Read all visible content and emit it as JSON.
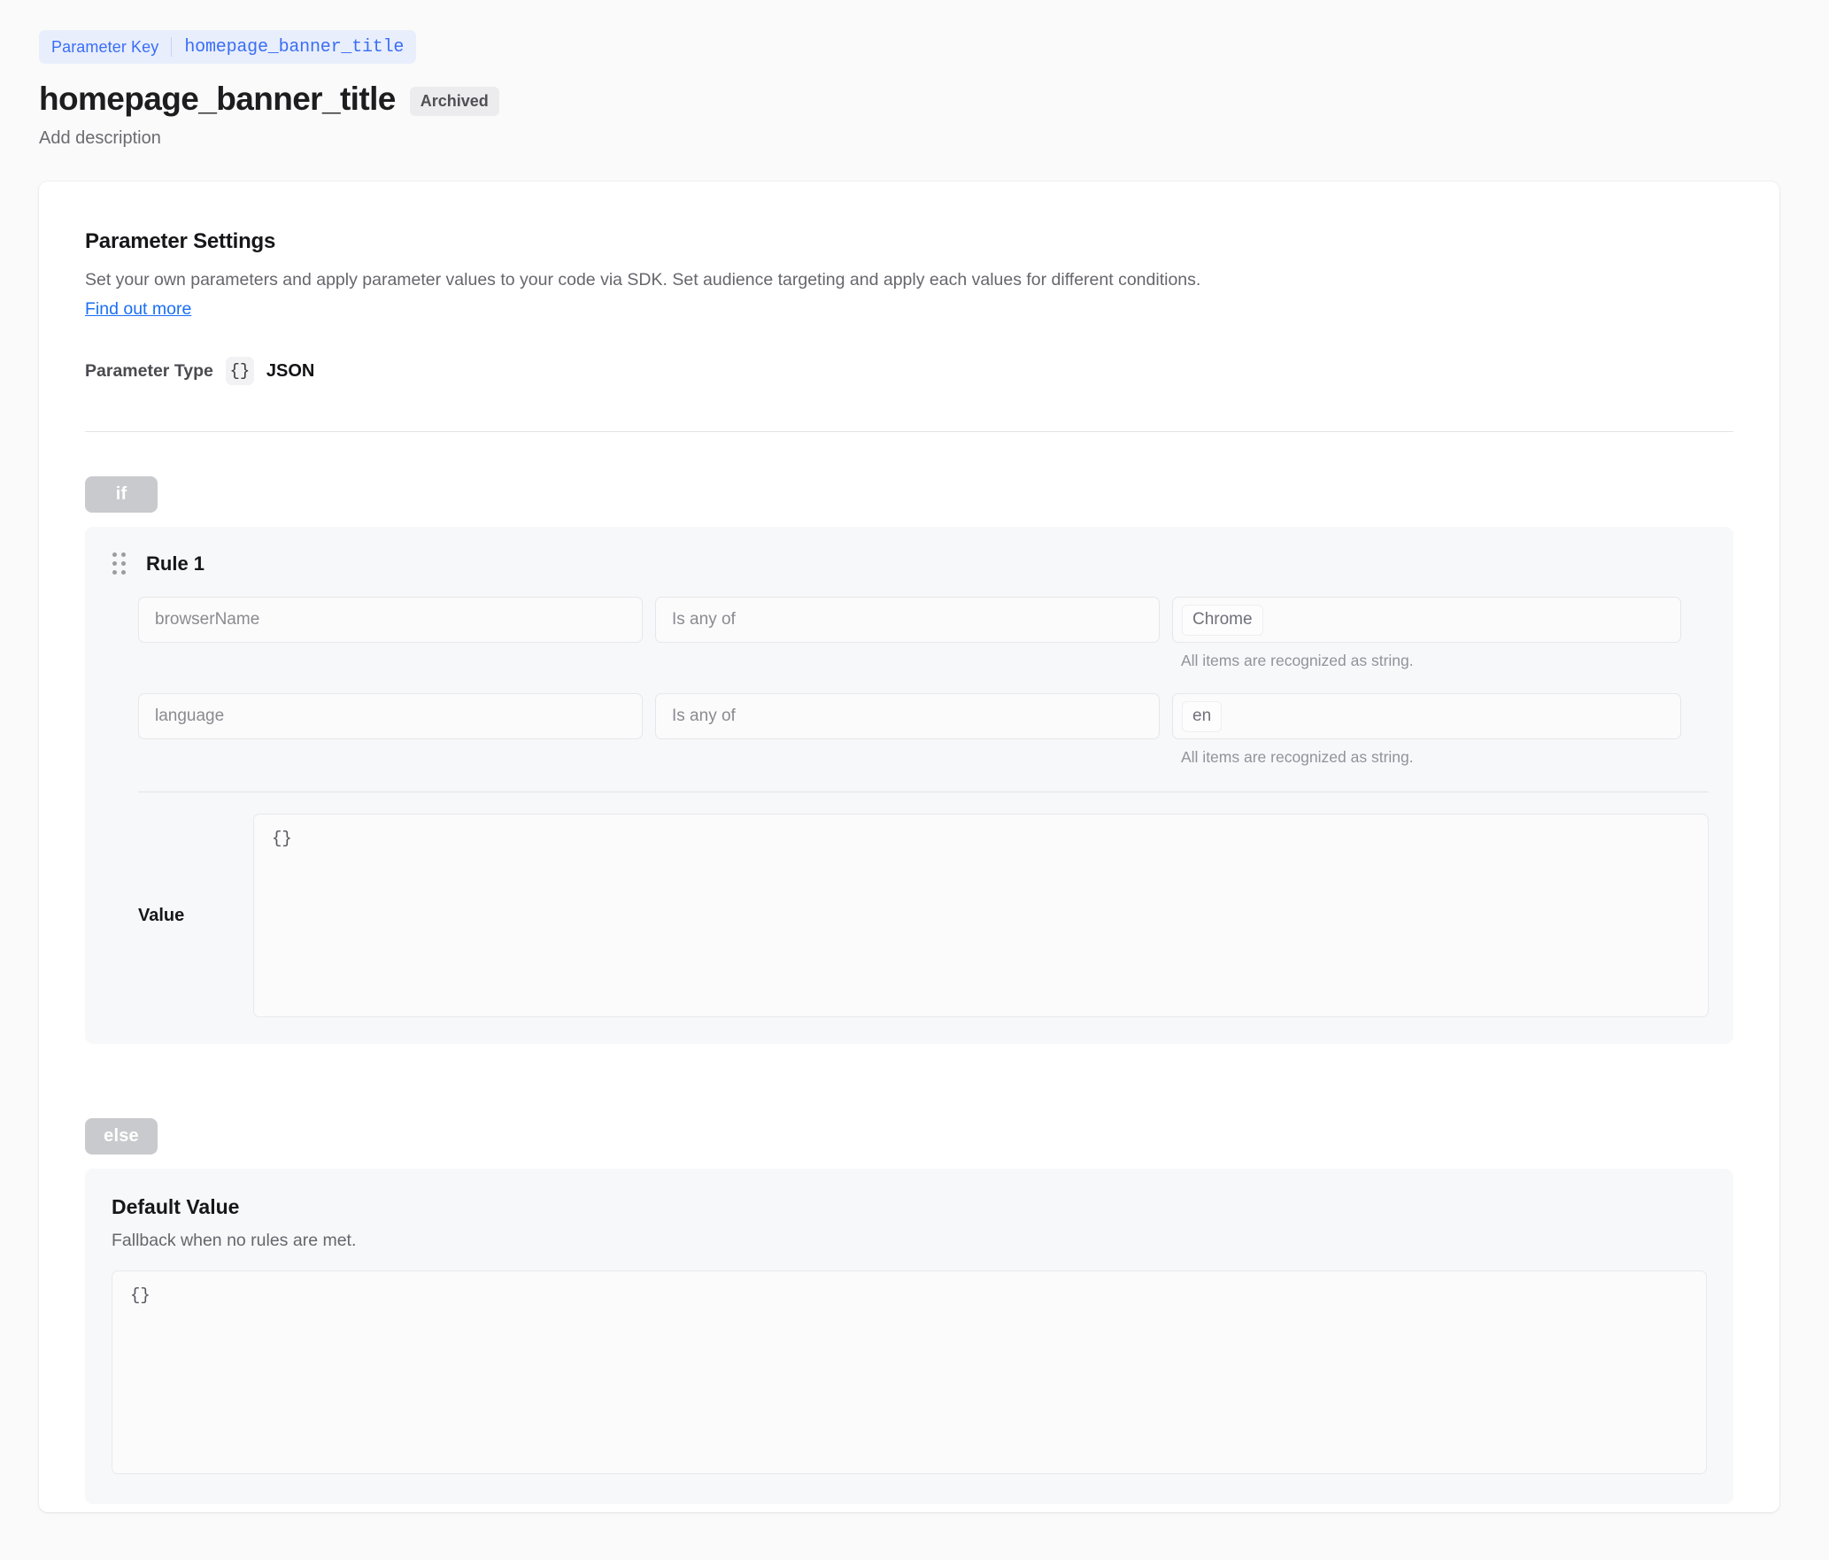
{
  "header": {
    "param_key_label": "Parameter Key",
    "param_key_value": "homepage_banner_title",
    "title": "homepage_banner_title",
    "status_badge": "Archived",
    "description_placeholder": "Add description"
  },
  "settings": {
    "section_title": "Parameter Settings",
    "section_desc": "Set your own parameters and apply parameter values to your code via SDK. Set audience targeting and apply each values for different conditions.",
    "find_out_more": "Find out more",
    "param_type_label": "Parameter Type",
    "param_type_icon": "json-braces-icon",
    "param_type_value": "JSON"
  },
  "conditions": {
    "if_label": "if",
    "else_label": "else",
    "rule": {
      "title": "Rule 1",
      "rows": [
        {
          "attribute": "browserName",
          "operator": "Is any of",
          "values": [
            "Chrome"
          ],
          "hint": "All items are recognized as string."
        },
        {
          "attribute": "language",
          "operator": "Is any of",
          "values": [
            "en"
          ],
          "hint": "All items are recognized as string."
        }
      ],
      "value_label": "Value",
      "value_code": "{}"
    },
    "default": {
      "title": "Default Value",
      "subtitle": "Fallback when no rules are met.",
      "code": "{}"
    }
  },
  "colors": {
    "accent_blue": "#3b6ef5",
    "link_blue": "#1a6ff5",
    "pill_bg": "#e8eefc",
    "badge_gray": "#c9cacd",
    "card_bg": "#f7f8fa"
  }
}
